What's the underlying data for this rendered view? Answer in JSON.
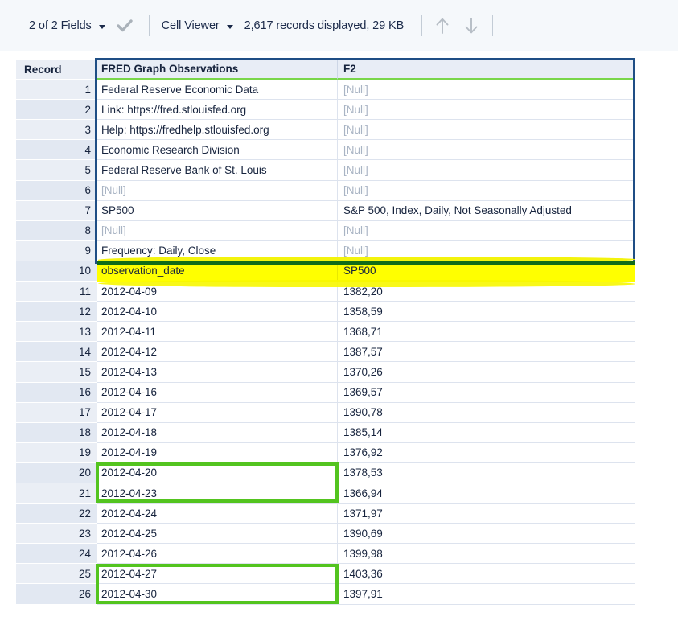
{
  "toolbar": {
    "fields_label": "2 of 2 Fields",
    "fields_caret_icon": "chevron-down-icon",
    "confirm_icon": "checkmark-icon",
    "viewer_label": "Cell Viewer",
    "viewer_caret_icon": "chevron-down-icon",
    "records_status": "2,617 records displayed, 29 KB",
    "up_icon": "arrow-up-icon",
    "down_icon": "arrow-down-icon"
  },
  "grid": {
    "columns": {
      "record": "Record",
      "col1": "FRED Graph Observations",
      "col2": "F2"
    },
    "null_text": "[Null]",
    "rows": [
      {
        "n": "1",
        "c1": "Federal Reserve Economic Data",
        "c2": "[Null]",
        "c1null": false,
        "c2null": true
      },
      {
        "n": "2",
        "c1": "Link: https://fred.stlouisfed.org",
        "c2": "[Null]",
        "c1null": false,
        "c2null": true
      },
      {
        "n": "3",
        "c1": "Help: https://fredhelp.stlouisfed.org",
        "c2": "[Null]",
        "c1null": false,
        "c2null": true
      },
      {
        "n": "4",
        "c1": "Economic Research Division",
        "c2": "[Null]",
        "c1null": false,
        "c2null": true
      },
      {
        "n": "5",
        "c1": "Federal Reserve Bank of St. Louis",
        "c2": "[Null]",
        "c1null": false,
        "c2null": true
      },
      {
        "n": "6",
        "c1": "[Null]",
        "c2": "[Null]",
        "c1null": true,
        "c2null": true
      },
      {
        "n": "7",
        "c1": "SP500",
        "c2": "S&P 500, Index, Daily, Not Seasonally Adjusted",
        "c1null": false,
        "c2null": false
      },
      {
        "n": "8",
        "c1": "[Null]",
        "c2": "[Null]",
        "c1null": true,
        "c2null": true
      },
      {
        "n": "9",
        "c1": "Frequency: Daily, Close",
        "c2": "[Null]",
        "c1null": false,
        "c2null": true
      },
      {
        "n": "10",
        "c1": "observation_date",
        "c2": "SP500",
        "c1null": false,
        "c2null": false,
        "highlight": "yellow"
      },
      {
        "n": "11",
        "c1": "2012-04-09",
        "c2": "1382,20",
        "c1null": false,
        "c2null": false
      },
      {
        "n": "12",
        "c1": "2012-04-10",
        "c2": "1358,59",
        "c1null": false,
        "c2null": false
      },
      {
        "n": "13",
        "c1": "2012-04-11",
        "c2": "1368,71",
        "c1null": false,
        "c2null": false
      },
      {
        "n": "14",
        "c1": "2012-04-12",
        "c2": "1387,57",
        "c1null": false,
        "c2null": false
      },
      {
        "n": "15",
        "c1": "2012-04-13",
        "c2": "1370,26",
        "c1null": false,
        "c2null": false
      },
      {
        "n": "16",
        "c1": "2012-04-16",
        "c2": "1369,57",
        "c1null": false,
        "c2null": false
      },
      {
        "n": "17",
        "c1": "2012-04-17",
        "c2": "1390,78",
        "c1null": false,
        "c2null": false
      },
      {
        "n": "18",
        "c1": "2012-04-18",
        "c2": "1385,14",
        "c1null": false,
        "c2null": false
      },
      {
        "n": "19",
        "c1": "2012-04-19",
        "c2": "1376,92",
        "c1null": false,
        "c2null": false
      },
      {
        "n": "20",
        "c1": "2012-04-20",
        "c2": "1378,53",
        "c1null": false,
        "c2null": false
      },
      {
        "n": "21",
        "c1": "2012-04-23",
        "c2": "1366,94",
        "c1null": false,
        "c2null": false
      },
      {
        "n": "22",
        "c1": "2012-04-24",
        "c2": "1371,97",
        "c1null": false,
        "c2null": false
      },
      {
        "n": "23",
        "c1": "2012-04-25",
        "c2": "1390,69",
        "c1null": false,
        "c2null": false
      },
      {
        "n": "24",
        "c1": "2012-04-26",
        "c2": "1399,98",
        "c1null": false,
        "c2null": false
      },
      {
        "n": "25",
        "c1": "2012-04-27",
        "c2": "1403,36",
        "c1null": false,
        "c2null": false
      },
      {
        "n": "26",
        "c1": "2012-04-30",
        "c2": "1397,91",
        "c1null": false,
        "c2null": false
      }
    ]
  },
  "annotations": {
    "blue_box_color": "#1f4e85",
    "green_box_color": "#53c41f",
    "green_line_color": "#116b19",
    "yellow_highlight_color": "#ffff00",
    "header_underline_color": "#79d64a"
  }
}
